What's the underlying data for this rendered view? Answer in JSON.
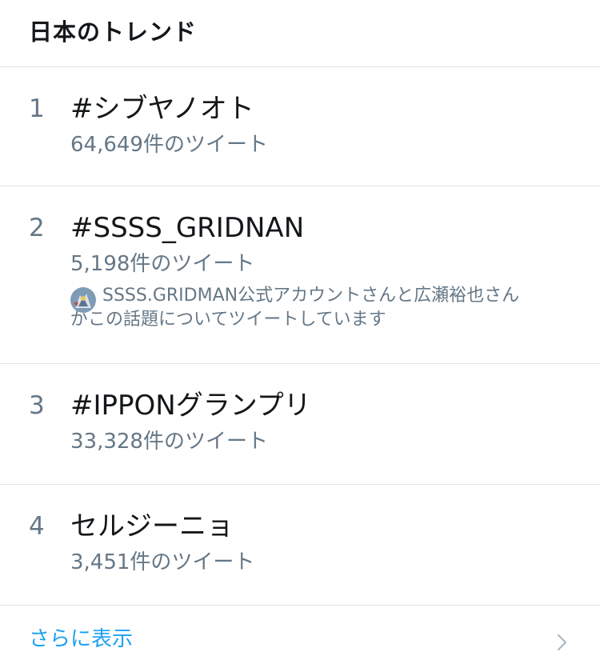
{
  "header": {
    "title": "日本のトレンド"
  },
  "trends": [
    {
      "rank": "1",
      "name": "#シブヤノオト",
      "tweet_count": "64,649件のツイート"
    },
    {
      "rank": "2",
      "name": "#SSSS_GRIDNAN",
      "tweet_count": "5,198件のツイート",
      "context_line1": "SSSS.GRIDMAN公式アカウントさんと広瀬裕也さん",
      "context_line2": "がこの話題についてツイートしています"
    },
    {
      "rank": "3",
      "name": "#IPPONグランプリ",
      "tweet_count": "33,328件のツイート"
    },
    {
      "rank": "4",
      "name": "セルジーニョ",
      "tweet_count": "3,451件のツイート"
    }
  ],
  "footer": {
    "show_more_label": "さらに表示",
    "chevron_icon": "chevron-right-icon"
  },
  "colors": {
    "primary_text": "#14171a",
    "secondary_text": "#657786",
    "accent": "#1da1f2",
    "divider": "#e1e8ed"
  }
}
